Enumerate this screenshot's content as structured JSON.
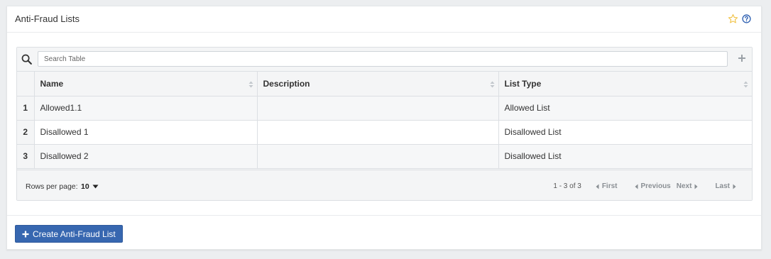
{
  "header": {
    "title": "Anti-Fraud Lists",
    "favorite_icon": "star-outline-icon",
    "help_icon": "question-circle-icon",
    "star_color": "#f0c040",
    "help_color": "#2a5db0"
  },
  "search": {
    "placeholder": "Search Table",
    "value": ""
  },
  "table": {
    "columns": [
      "Name",
      "Description",
      "List Type"
    ],
    "rows": [
      {
        "index": "1",
        "name": "Allowed1.1",
        "description": "",
        "list_type": "Allowed List"
      },
      {
        "index": "2",
        "name": "Disallowed 1",
        "description": "",
        "list_type": "Disallowed List"
      },
      {
        "index": "3",
        "name": "Disallowed 2",
        "description": "",
        "list_type": "Disallowed List"
      }
    ]
  },
  "footer": {
    "rows_per_page_label": "Rows per page:",
    "rows_per_page_value": "10",
    "range": "1 - 3 of 3",
    "first": "First",
    "previous": "Previous",
    "next": "Next",
    "last": "Last"
  },
  "actions": {
    "create_label": "Create Anti-Fraud List",
    "accent_color": "#3767b0"
  }
}
